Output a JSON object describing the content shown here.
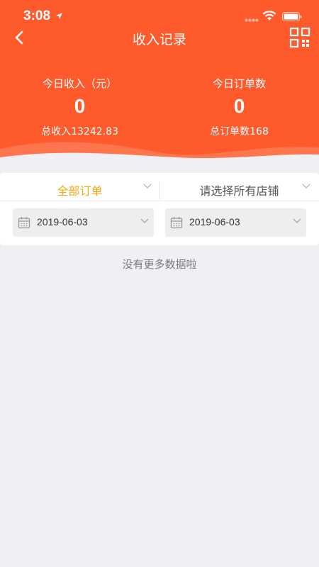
{
  "status_bar": {
    "time": "3:08"
  },
  "nav": {
    "title": "收入记录"
  },
  "stats": {
    "today_income_label": "今日收入（元）",
    "today_income_value": "0",
    "total_income": "总收入13242.83",
    "today_orders_label": "今日订单数",
    "today_orders_value": "0",
    "total_orders": "总订单数168"
  },
  "filters": {
    "order_type": "全部订单",
    "store": "请选择所有店铺",
    "start_date": "2019-06-03",
    "end_date": "2019-06-03"
  },
  "list": {
    "empty_text": "没有更多数据啦"
  },
  "colors": {
    "header": "#fe5a2c",
    "accent": "#f5a90c",
    "background": "#efeff4"
  }
}
